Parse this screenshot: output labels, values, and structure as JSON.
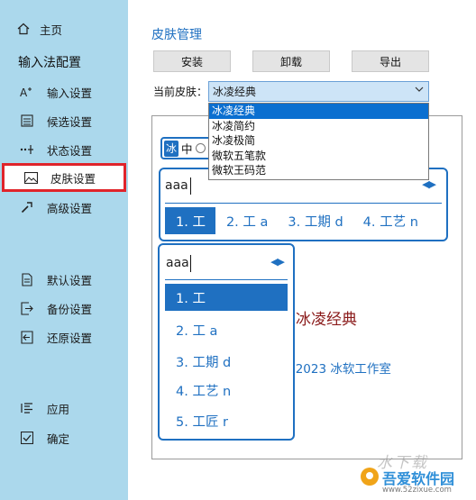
{
  "sidebar": {
    "home": "主页",
    "heading": "输入法配置",
    "items": [
      {
        "label": "输入设置",
        "icon": "font-size-icon"
      },
      {
        "label": "候选设置",
        "icon": "list-box-icon"
      },
      {
        "label": "状态设置",
        "icon": "status-dots-icon"
      },
      {
        "label": "皮肤设置",
        "icon": "image-icon"
      },
      {
        "label": "高级设置",
        "icon": "wrench-icon"
      },
      {
        "label": "默认设置",
        "icon": "document-icon"
      },
      {
        "label": "备份设置",
        "icon": "export-icon"
      },
      {
        "label": "还原设置",
        "icon": "import-icon"
      },
      {
        "label": "应用",
        "icon": "apply-list-icon"
      },
      {
        "label": "确定",
        "icon": "checkbox-icon"
      }
    ]
  },
  "main": {
    "title": "皮肤管理",
    "buttons": {
      "install": "安装",
      "uninstall": "卸载",
      "export": "导出"
    },
    "current_skin_label": "当前皮肤：",
    "current_skin_value": "冰凌经典",
    "skin_options": [
      "冰凌经典",
      "冰凌简约",
      "冰凌极简",
      "微软五笔款",
      "微软王码范"
    ]
  },
  "preview": {
    "status": {
      "ime_char": "冰",
      "mode": "中"
    },
    "horizontal": {
      "code": "aaa",
      "candidates": [
        "1. 工",
        "2. 工 a",
        "3. 工期 d",
        "4. 工艺 n"
      ]
    },
    "vertical": {
      "code": "aaa",
      "candidates": [
        "1. 工",
        "2. 工 a",
        "3. 工期 d",
        "4. 工艺 n",
        "5. 工匠 r"
      ]
    },
    "skin_name": "冰凌经典",
    "copyright": "（C） 2023 冰软工作室"
  },
  "watermark": {
    "top": "水下载",
    "main": "吾爱软件园",
    "url": "www.52zixue.com"
  },
  "colors": {
    "sidebar_bg": "#abd8ec",
    "accent": "#1f70c1",
    "selection_outline": "#e0242b",
    "skin_name": "#8a1a1a"
  }
}
